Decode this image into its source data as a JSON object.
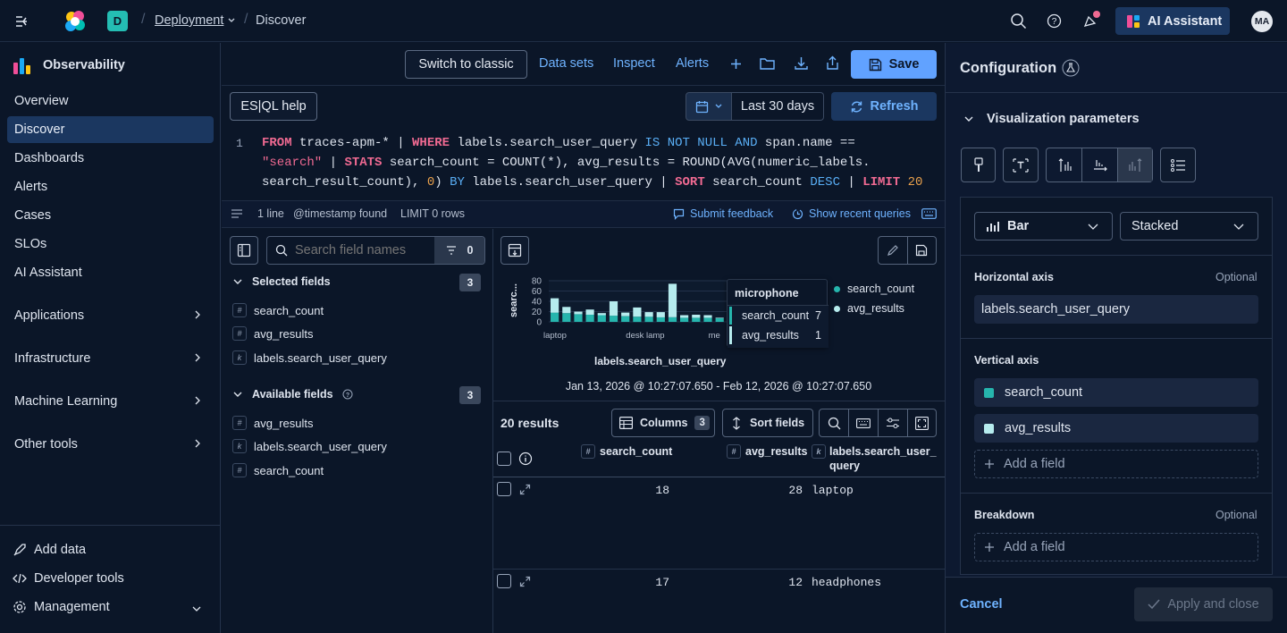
{
  "header": {
    "space_letter": "D",
    "breadcrumb": [
      "Deployment",
      "Discover"
    ],
    "ai_assistant_label": "AI Assistant",
    "avatar_initials": "MA"
  },
  "sidebar": {
    "solution": "Observability",
    "items": [
      {
        "label": "Overview"
      },
      {
        "label": "Discover",
        "active": true
      },
      {
        "label": "Dashboards"
      },
      {
        "label": "Alerts"
      },
      {
        "label": "Cases"
      },
      {
        "label": "SLOs"
      },
      {
        "label": "AI Assistant"
      }
    ],
    "groups": [
      {
        "label": "Applications"
      },
      {
        "label": "Infrastructure"
      },
      {
        "label": "Machine Learning"
      },
      {
        "label": "Other tools"
      }
    ],
    "bottom": [
      {
        "label": "Add data"
      },
      {
        "label": "Developer tools"
      },
      {
        "label": "Management"
      }
    ]
  },
  "toolbar": {
    "switch_classic": "Switch to classic",
    "data_sets": "Data sets",
    "inspect": "Inspect",
    "alerts": "Alerts",
    "save": "Save",
    "esql_help": "ES|QL help",
    "time_range": "Last 30 days",
    "refresh": "Refresh"
  },
  "query": {
    "line_number": "1",
    "meta_lines": "1 line",
    "meta_timestamp": "@timestamp found",
    "meta_limit": "LIMIT 0 rows",
    "submit_feedback": "Submit feedback",
    "recent_queries": "Show recent queries"
  },
  "fields": {
    "search_placeholder": "Search field names",
    "filter_count": "0",
    "selected_title": "Selected fields",
    "selected_count": "3",
    "selected": [
      {
        "type": "#",
        "name": "search_count"
      },
      {
        "type": "#",
        "name": "avg_results"
      },
      {
        "type": "k",
        "name": "labels.search_user_query"
      }
    ],
    "available_title": "Available fields",
    "available_count": "3",
    "available": [
      {
        "type": "#",
        "name": "avg_results"
      },
      {
        "type": "k",
        "name": "labels.search_user_query"
      },
      {
        "type": "#",
        "name": "search_count"
      }
    ]
  },
  "chart": {
    "y_title": "searc...",
    "x_title": "labels.search_user_query",
    "x_ticks": [
      "laptop",
      "desk lamp",
      "me"
    ],
    "legend": [
      "search_count",
      "avg_results"
    ],
    "time_range_text": "Jan 13, 2026 @ 10:27:07.650 - Feb 12, 2026 @ 10:27:07.650",
    "tooltip": {
      "title": "microphone",
      "rows": [
        {
          "label": "search_count",
          "value": "7"
        },
        {
          "label": "avg_results",
          "value": "1"
        }
      ]
    },
    "colors": {
      "search_count": "#26b5ad",
      "avg_results": "#b6ecee"
    }
  },
  "chart_data": {
    "type": "bar",
    "stacked": true,
    "y_ticks": [
      "80",
      "60",
      "40",
      "20",
      "0"
    ],
    "ylim": [
      0,
      80
    ],
    "series": [
      {
        "name": "search_count",
        "values": [
          18,
          17,
          15,
          14,
          13,
          12,
          11,
          10,
          10,
          9,
          9,
          8,
          8,
          8,
          7,
          7
        ]
      },
      {
        "name": "avg_results",
        "values": [
          28,
          12,
          5,
          10,
          4,
          28,
          7,
          18,
          9,
          10,
          65,
          5,
          6,
          5,
          1,
          5
        ]
      }
    ]
  },
  "results": {
    "count_label": "20 results",
    "columns_label": "Columns",
    "columns_count": "3",
    "sort_label": "Sort fields",
    "headers": [
      "search_count",
      "avg_results",
      "labels.search_user_query"
    ],
    "rows": [
      {
        "search_count": "18",
        "avg_results": "28",
        "query": "laptop"
      },
      {
        "search_count": "17",
        "avg_results": "12",
        "query": "headphones"
      }
    ]
  },
  "config": {
    "title": "Configuration",
    "section": "Visualization parameters",
    "chart_type": "Bar",
    "stack_mode": "Stacked",
    "horizontal_axis_label": "Horizontal axis",
    "optional": "Optional",
    "horizontal_axis_value": "labels.search_user_query",
    "vertical_axis_label": "Vertical axis",
    "vertical_axis_fields": [
      "search_count",
      "avg_results"
    ],
    "add_field": "Add a field",
    "breakdown_label": "Breakdown",
    "cancel": "Cancel",
    "apply": "Apply and close"
  }
}
